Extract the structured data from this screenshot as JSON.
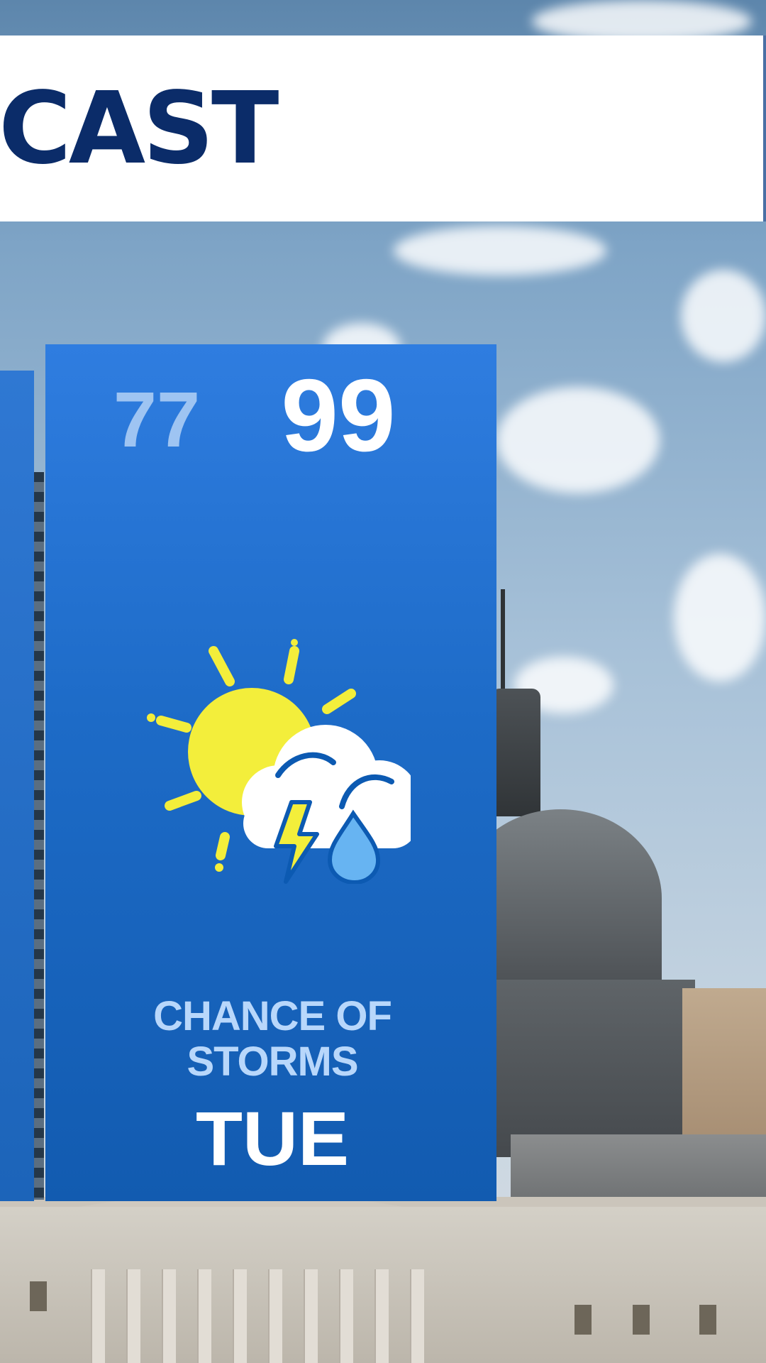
{
  "header": {
    "title": "CAST"
  },
  "forecast": {
    "low_temp": "77",
    "high_temp": "99",
    "condition_line1": "CHANCE OF",
    "condition_line2": "STORMS",
    "day": "TUE",
    "icon": "partly-sunny-thunderstorm-icon"
  },
  "colors": {
    "header_bar": "#ffffff",
    "header_text": "#0b2c69",
    "card_top": "#2f7de0",
    "card_bottom": "#125bb0",
    "low_temp": "#9ec4f2",
    "condition_text": "#b8d7fb",
    "sun": "#f3ee3b",
    "rain": "#67b4f2"
  }
}
